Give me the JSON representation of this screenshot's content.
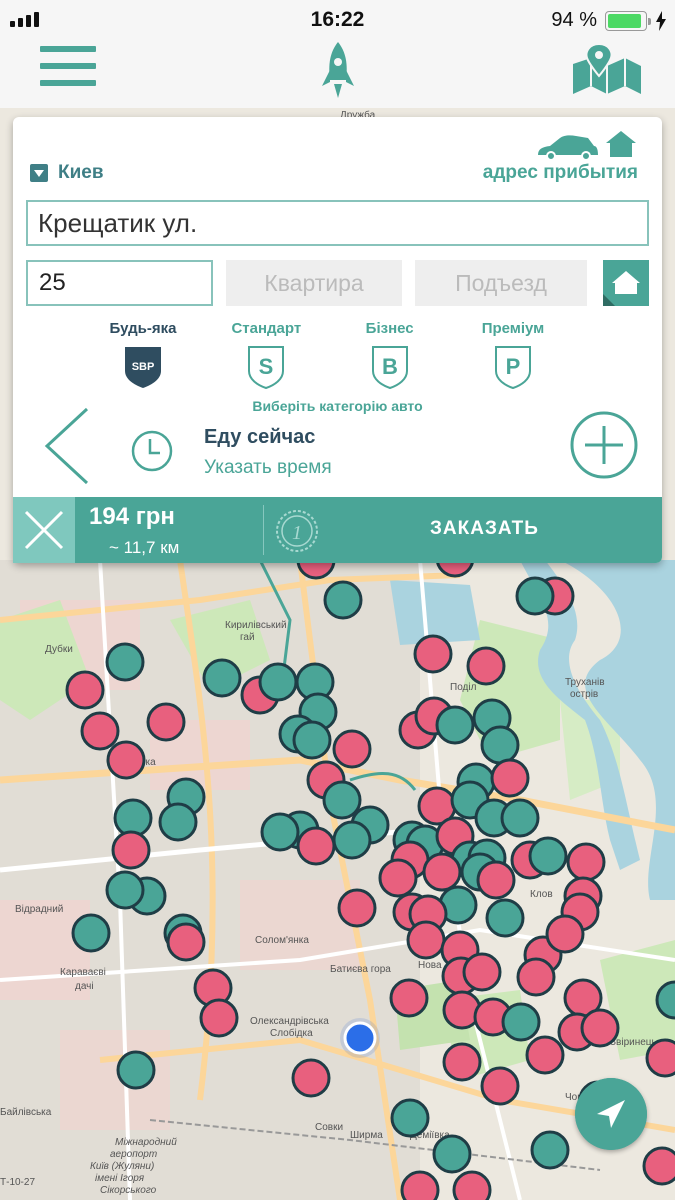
{
  "status": {
    "time": "16:22",
    "battery": "94 %"
  },
  "header": {
    "menu_icon": "menu-icon",
    "logo_icon": "rocket-icon",
    "map_icon": "map-pin-icon"
  },
  "form": {
    "city": "Киев",
    "arrival_label": "адрес прибытия",
    "street": "Крещатик ул.",
    "house": "25",
    "flat_placeholder": "Квартира",
    "entrance_placeholder": "Подъезд",
    "categories": [
      {
        "label": "Будь-яка",
        "letter": "SBP",
        "selected": true
      },
      {
        "label": "Стандарт",
        "letter": "S",
        "selected": false
      },
      {
        "label": "Бізнес",
        "letter": "B",
        "selected": false
      },
      {
        "label": "Преміум",
        "letter": "P",
        "selected": false
      }
    ],
    "category_hint": "Виберіть категорію авто",
    "time_now": "Еду сейчас",
    "time_set": "Указать время"
  },
  "order": {
    "price": "194 грн",
    "distance": "~ 11,7 км",
    "badge": "1",
    "button": "ЗАКАЗАТЬ"
  },
  "map": {
    "labels": [
      "Дружба",
      "Кирилівський гай",
      "Поділ",
      "Труханів острів",
      "Шулявка",
      "Відрадний",
      "Караваєві дачі",
      "Солом'янка",
      "Батиєва гора",
      "Олександрівська Слобідка",
      "Звіринець",
      "Чорна гора",
      "Совки",
      "Ширма",
      "Деміївка",
      "Міжнародний аеропорт Київ (Жуляни) імені Ігоря Сікорського",
      "Байлівська",
      "Дубки",
      "Клов",
      "Нова",
      "Т-10-27"
    ],
    "colors": {
      "car_free": "#4aa597",
      "car_busy": "#e8607e"
    }
  }
}
